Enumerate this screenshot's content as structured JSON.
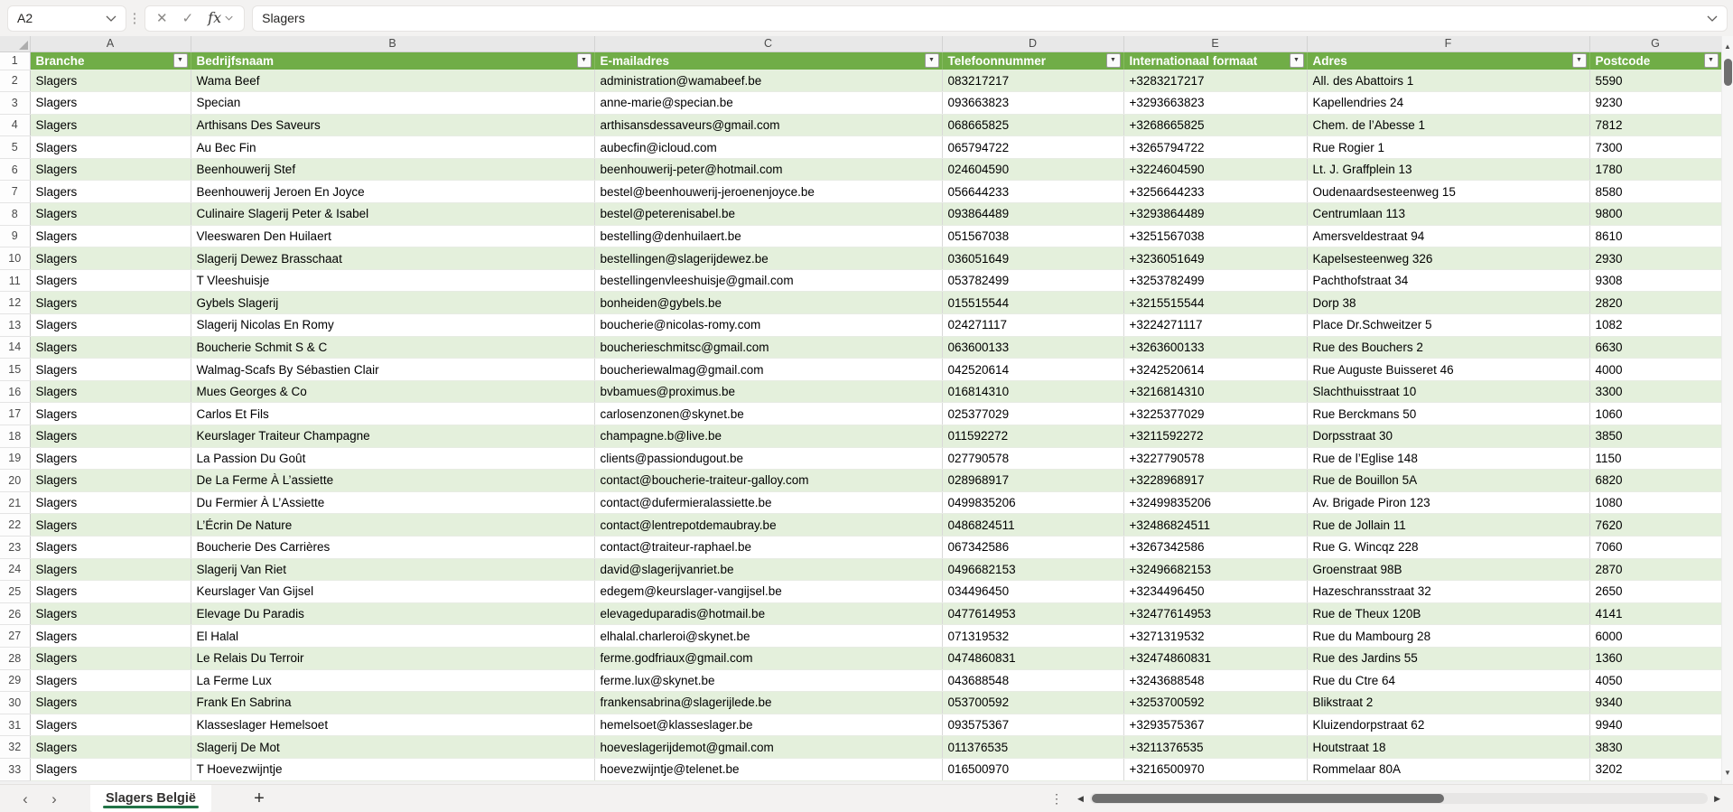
{
  "formula_bar": {
    "name_box": "A2",
    "formula": "Slagers"
  },
  "icons": {
    "cancel": "✕",
    "confirm": "✓",
    "fx": "fx",
    "more_dots": "⋮",
    "filter": "▼",
    "scroll_up": "▲",
    "scroll_down": "▼",
    "scroll_left": "◀",
    "scroll_right": "▶",
    "prev_sheet": "‹",
    "next_sheet": "›",
    "add_sheet": "+",
    "tab_options": "⋮"
  },
  "tabs": {
    "active": "Slagers België"
  },
  "colors": {
    "header_bg": "#70AD47",
    "band_green": "#E4F0DC",
    "tab_underline": "#217346"
  },
  "sheet": {
    "column_letters": [
      "A",
      "B",
      "C",
      "D",
      "E",
      "F",
      "G"
    ],
    "header_row_number": "1",
    "headers": [
      "Branche",
      "Bedrijfsnaam",
      "E-mailadres",
      "Telefoonnummer",
      "Internationaal formaat",
      "Adres",
      "Postcode"
    ],
    "first_row_number": 2,
    "rows": [
      [
        "Slagers",
        "Wama Beef",
        "administration@wamabeef.be",
        "083217217",
        "+3283217217",
        "All. des Abattoirs 1",
        "5590"
      ],
      [
        "Slagers",
        "Specian",
        "anne-marie@specian.be",
        "093663823",
        "+3293663823",
        "Kapellendries 24",
        "9230"
      ],
      [
        "Slagers",
        "Arthisans Des Saveurs",
        "arthisansdessaveurs@gmail.com",
        "068665825",
        "+3268665825",
        "Chem. de l’Abesse 1",
        "7812"
      ],
      [
        "Slagers",
        "Au Bec Fin",
        "aubecfin@icloud.com",
        "065794722",
        "+3265794722",
        "Rue Rogier 1",
        "7300"
      ],
      [
        "Slagers",
        "Beenhouwerij Stef",
        "beenhouwerij-peter@hotmail.com",
        "024604590",
        "+3224604590",
        "Lt. J. Graffplein 13",
        "1780"
      ],
      [
        "Slagers",
        "Beenhouwerij Jeroen En Joyce",
        "bestel@beenhouwerij-jeroenenjoyce.be",
        "056644233",
        "+3256644233",
        "Oudenaardsesteenweg 15",
        "8580"
      ],
      [
        "Slagers",
        "Culinaire Slagerij Peter & Isabel",
        "bestel@peterenisabel.be",
        "093864489",
        "+3293864489",
        "Centrumlaan 113",
        "9800"
      ],
      [
        "Slagers",
        "Vleeswaren Den Huilaert",
        "bestelling@denhuilaert.be",
        "051567038",
        "+3251567038",
        "Amersveldestraat 94",
        "8610"
      ],
      [
        "Slagers",
        "Slagerij Dewez Brasschaat",
        "bestellingen@slagerijdewez.be",
        "036051649",
        "+3236051649",
        "Kapelsesteenweg 326",
        "2930"
      ],
      [
        "Slagers",
        "T Vleeshuisje",
        "bestellingenvleeshuisje@gmail.com",
        "053782499",
        "+3253782499",
        "Pachthofstraat 34",
        "9308"
      ],
      [
        "Slagers",
        "Gybels Slagerij",
        "bonheiden@gybels.be",
        "015515544",
        "+3215515544",
        "Dorp 38",
        "2820"
      ],
      [
        "Slagers",
        "Slagerij Nicolas En Romy",
        "boucherie@nicolas-romy.com",
        "024271117",
        "+3224271117",
        "Place Dr.Schweitzer 5",
        "1082"
      ],
      [
        "Slagers",
        "Boucherie Schmit S & C",
        "boucherieschmitsc@gmail.com",
        "063600133",
        "+3263600133",
        "Rue des Bouchers 2",
        "6630"
      ],
      [
        "Slagers",
        "Walmag-Scafs By Sébastien Clair",
        "boucheriewalmag@gmail.com",
        "042520614",
        "+3242520614",
        "Rue Auguste Buisseret 46",
        "4000"
      ],
      [
        "Slagers",
        "Mues Georges & Co",
        "bvbamues@proximus.be",
        "016814310",
        "+3216814310",
        "Slachthuisstraat 10",
        "3300"
      ],
      [
        "Slagers",
        "Carlos Et Fils",
        "carlosenzonen@skynet.be",
        "025377029",
        "+3225377029",
        "Rue Berckmans 50",
        "1060"
      ],
      [
        "Slagers",
        "Keurslager Traiteur Champagne",
        "champagne.b@live.be",
        "011592272",
        "+3211592272",
        "Dorpsstraat 30",
        "3850"
      ],
      [
        "Slagers",
        "La Passion Du Goût",
        "clients@passiondugout.be",
        "027790578",
        "+3227790578",
        "Rue de l’Eglise 148",
        "1150"
      ],
      [
        "Slagers",
        "De La Ferme À L’assiette",
        "contact@boucherie-traiteur-galloy.com",
        "028968917",
        "+3228968917",
        "Rue de Bouillon 5A",
        "6820"
      ],
      [
        "Slagers",
        "Du Fermier À L’Assiette",
        "contact@dufermieralassiette.be",
        "0499835206",
        "+32499835206",
        "Av. Brigade Piron 123",
        "1080"
      ],
      [
        "Slagers",
        "L’Écrin De Nature",
        "contact@lentrepotdemaubray.be",
        "0486824511",
        "+32486824511",
        "Rue de Jollain 11",
        "7620"
      ],
      [
        "Slagers",
        "Boucherie Des Carrières",
        "contact@traiteur-raphael.be",
        "067342586",
        "+3267342586",
        "Rue G. Wincqz 228",
        "7060"
      ],
      [
        "Slagers",
        "Slagerij Van Riet",
        "david@slagerijvanriet.be",
        "0496682153",
        "+32496682153",
        "Groenstraat 98B",
        "2870"
      ],
      [
        "Slagers",
        "Keurslager Van Gijsel",
        "edegem@keurslager-vangijsel.be",
        "034496450",
        "+3234496450",
        "Hazeschransstraat 32",
        "2650"
      ],
      [
        "Slagers",
        "Elevage Du Paradis",
        "elevageduparadis@hotmail.be",
        "0477614953",
        "+32477614953",
        "Rue de Theux 120B",
        "4141"
      ],
      [
        "Slagers",
        "El Halal",
        "elhalal.charleroi@skynet.be",
        "071319532",
        "+3271319532",
        "Rue du Mambourg 28",
        "6000"
      ],
      [
        "Slagers",
        "Le Relais Du Terroir",
        "ferme.godfriaux@gmail.com",
        "0474860831",
        "+32474860831",
        "Rue des Jardins 55",
        "1360"
      ],
      [
        "Slagers",
        "La Ferme Lux",
        "ferme.lux@skynet.be",
        "043688548",
        "+3243688548",
        "Rue du Ctre 64",
        "4050"
      ],
      [
        "Slagers",
        "Frank En Sabrina",
        "frankensabrina@slagerijlede.be",
        "053700592",
        "+3253700592",
        "Blikstraat 2",
        "9340"
      ],
      [
        "Slagers",
        "Klasseslager Hemelsoet",
        "hemelsoet@klasseslager.be",
        "093575367",
        "+3293575367",
        "Kluizendorpstraat 62",
        "9940"
      ],
      [
        "Slagers",
        "Slagerij De Mot",
        "hoeveslagerijdemot@gmail.com",
        "011376535",
        "+3211376535",
        "Houtstraat 18",
        "3830"
      ],
      [
        "Slagers",
        "T Hoevezwijntje",
        "hoevezwijntje@telenet.be",
        "016500970",
        "+3216500970",
        "Rommelaar 80A",
        "3202"
      ]
    ]
  }
}
